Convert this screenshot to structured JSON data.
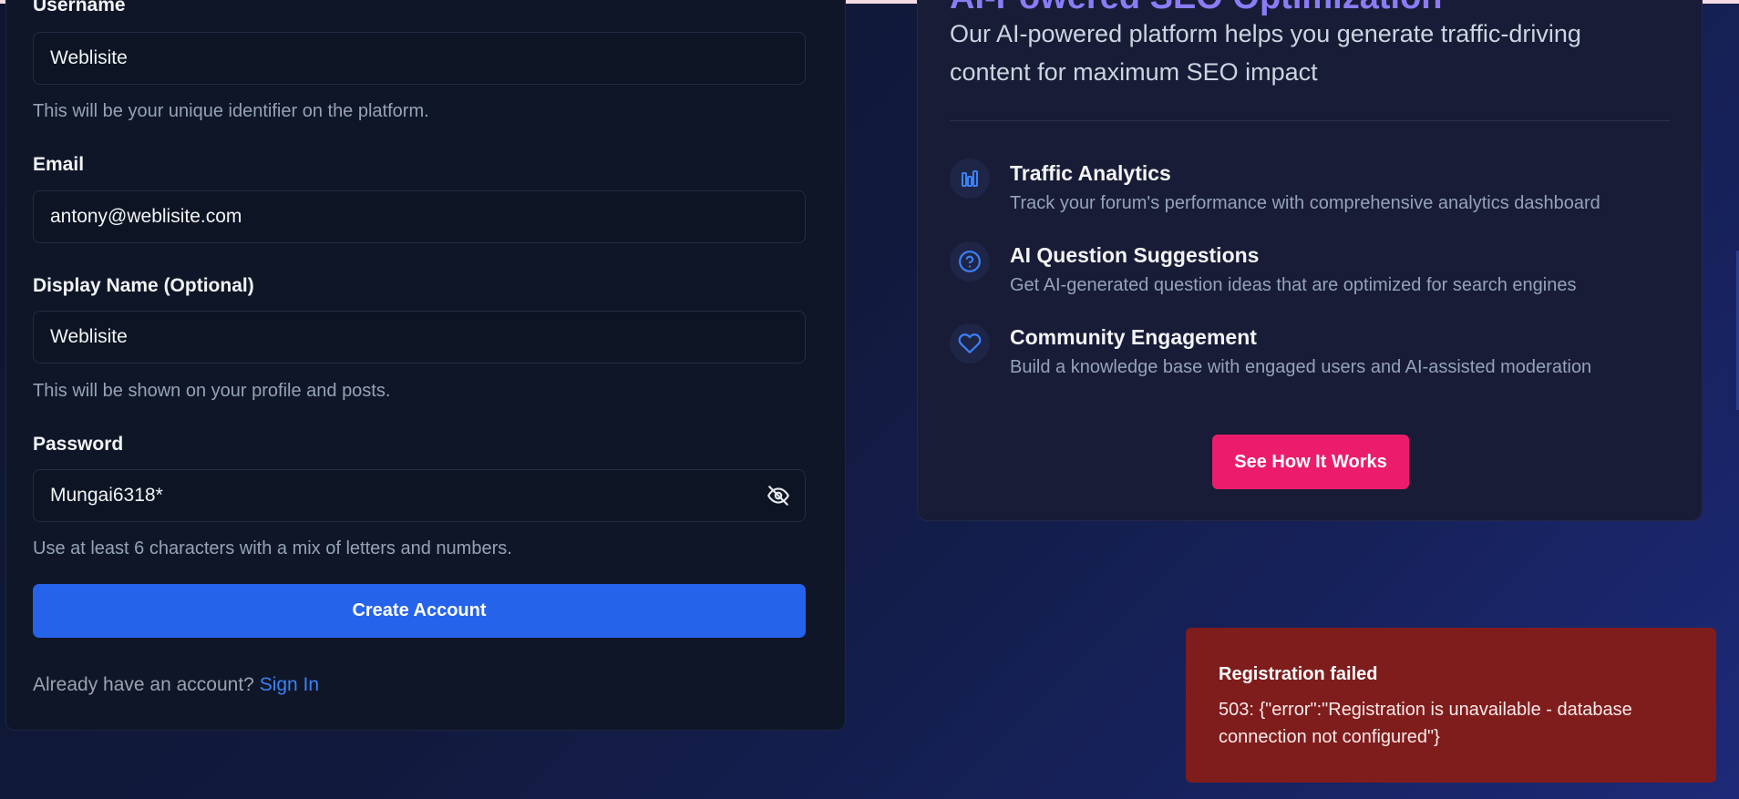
{
  "form": {
    "username": {
      "label": "Username",
      "value": "Weblisite",
      "hint": "This will be your unique identifier on the platform."
    },
    "email": {
      "label": "Email",
      "value": "antony@weblisite.com"
    },
    "display_name": {
      "label": "Display Name (Optional)",
      "value": "Weblisite",
      "hint": "This will be shown on your profile and posts."
    },
    "password": {
      "label": "Password",
      "value": "Mungai6318*",
      "hint": "Use at least 6 characters with a mix of letters and numbers."
    },
    "create_label": "Create Account",
    "already_text": "Already have an account?",
    "signin_label": "Sign In"
  },
  "info": {
    "heading": "AI-Powered SEO Optimization",
    "subtitle": "Our AI-powered platform helps you generate traffic-driving content for maximum SEO impact",
    "features": [
      {
        "icon": "bar-chart-icon",
        "title": "Traffic Analytics",
        "desc": "Track your forum's performance with comprehensive analytics dashboard"
      },
      {
        "icon": "question-circle-icon",
        "title": "AI Question Suggestions",
        "desc": "Get AI-generated question ideas that are optimized for search engines"
      },
      {
        "icon": "heart-icon",
        "title": "Community Engagement",
        "desc": "Build a knowledge base with engaged users and AI-assisted moderation"
      }
    ],
    "cta_label": "See How It Works"
  },
  "toast": {
    "title": "Registration failed",
    "message": "503: {\"error\":\"Registration is unavailable - database connection not configured\"}"
  },
  "colors": {
    "primary": "#2563eb",
    "accent": "#ec1c6c",
    "error": "#7f1d1d",
    "link": "#3b82f6"
  }
}
